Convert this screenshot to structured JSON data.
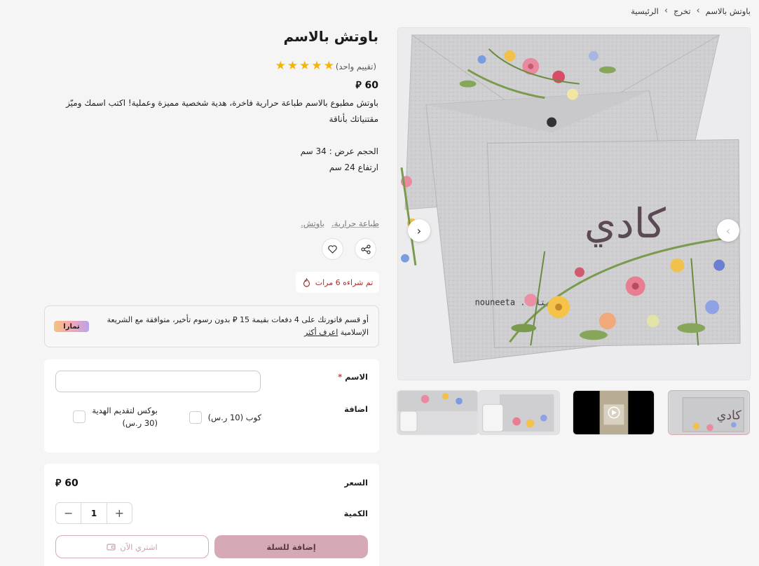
{
  "breadcrumb": {
    "home": "الرئيسية",
    "category": "تخرج",
    "current": "باوتش بالاسم",
    "sep": "›"
  },
  "product": {
    "title": "باوتش بالاسم",
    "rating_text": "(تقييم واحد)",
    "rating_value": 5,
    "price": "60 ⃁",
    "description_line1": "باوتش مطبوع بالاسم طباعة حرارية فاخرة، هدية شخصية مميزة وعملية! اكتب اسمك وميّز",
    "description_line2": "مقتنياتك بأناقة",
    "size_width": "الحجم عرض : 34 سم",
    "size_height": "ارتفاع 24 سم",
    "tags": [
      "باوتش.",
      "طباعة حرارية."
    ],
    "sold_badge": "تم شراءه 6 مرات",
    "image_watermark": "nouneeta .. نوليتا",
    "image_name_art": "كادي"
  },
  "tamara": {
    "text": "أو قسم فاتورتك على 4 دفعات بقيمة 15 ⃁ بدون رسوم تأخير، متوافقة مع الشريعة الإسلامية",
    "learn_more": "اعرف أكثر",
    "logo": "تمارا",
    "logo_gradient": [
      "#f4c37a",
      "#f3a6b7",
      "#b9a4e8"
    ]
  },
  "options": {
    "name_label": "الاسم",
    "required_mark": "*",
    "name_value": "",
    "addon_label": "اضافة",
    "addons": [
      {
        "label": "كوب (10 ر.س)",
        "checked": false
      },
      {
        "label_line1": "بوكس لتقديم الهدية",
        "label_line2": "(30 ر.س)",
        "checked": false
      }
    ]
  },
  "purchase": {
    "price_label": "السعر",
    "price": "60 ⃁",
    "quantity_label": "الكمية",
    "quantity": "1",
    "minus": "−",
    "plus": "+",
    "add_to_cart": "إضافة للسلة",
    "buy_now": "اشتري الآن"
  },
  "colors": {
    "accent_pink": "#d5aab4",
    "star": "#f5b400",
    "sold_red": "#a2302f"
  }
}
